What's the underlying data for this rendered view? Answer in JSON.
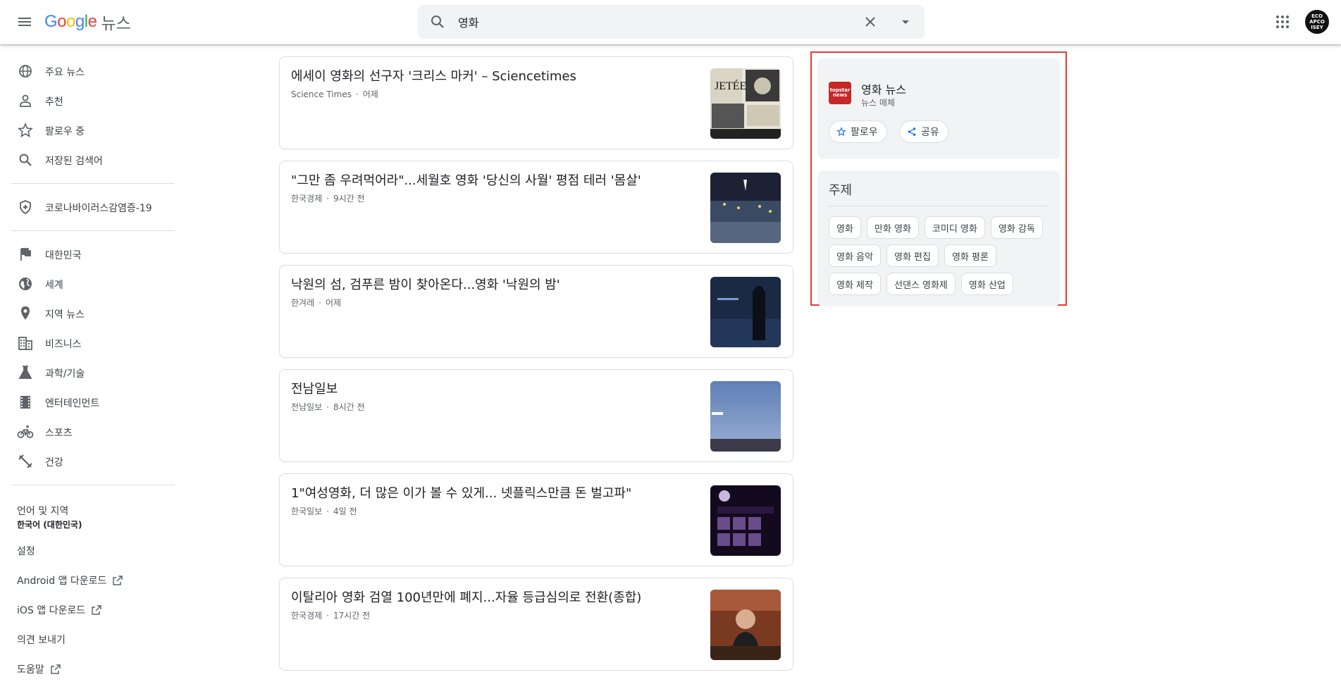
{
  "header": {
    "logo_google": "Google",
    "logo_news": "뉴스",
    "search_value": "영화",
    "avatar_text": "ECO APCO ISEY"
  },
  "sidebar": {
    "primary": [
      {
        "label": "주요 뉴스",
        "icon": "globe-icon"
      },
      {
        "label": "추천",
        "icon": "person-icon"
      },
      {
        "label": "팔로우 중",
        "icon": "star-icon"
      },
      {
        "label": "저장된 검색어",
        "icon": "search-icon"
      }
    ],
    "covid": {
      "label": "코로나바이러스감염증-19",
      "icon": "shield-icon"
    },
    "sections": [
      {
        "label": "대한민국",
        "icon": "flag-icon"
      },
      {
        "label": "세계",
        "icon": "world-icon"
      },
      {
        "label": "지역 뉴스",
        "icon": "location-icon"
      },
      {
        "label": "비즈니스",
        "icon": "building-icon"
      },
      {
        "label": "과학/기술",
        "icon": "flask-icon"
      },
      {
        "label": "엔터테인먼트",
        "icon": "film-icon"
      },
      {
        "label": "스포츠",
        "icon": "bike-icon"
      },
      {
        "label": "건강",
        "icon": "fitness-icon"
      }
    ],
    "language_label": "언어 및 지역",
    "language_value": "한국어 (대한민국)",
    "settings": "설정",
    "android": "Android 앱 다운로드",
    "ios": "iOS 앱 다운로드",
    "feedback": "의견 보내기",
    "help": "도움말"
  },
  "articles": [
    {
      "title": "에세이 영화의 선구자 '크리스 마커' – Sciencetimes",
      "source": "Science Times",
      "time": "어제"
    },
    {
      "title": "\"그만 좀 우려먹어라\"...세월호 영화 '당신의 사월' 평점 테러 '몸살'",
      "source": "한국경제",
      "time": "9시간 전"
    },
    {
      "title": "낙원의 섬, 검푸른 밤이 찾아온다...영화 '낙원의 밤'",
      "source": "한겨레",
      "time": "어제"
    },
    {
      "title": "전남일보",
      "source": "전남일보",
      "time": "8시간 전"
    },
    {
      "title": "1\"여성영화, 더 많은 이가 볼 수 있게... 넷플릭스만큼 돈 벌고파\"",
      "source": "한국일보",
      "time": "4일 전"
    },
    {
      "title": "이탈리아 영화 검열 100년만에 폐지...자율 등급심의로 전환(종합)",
      "source": "한국경제",
      "time": "17시간 전"
    }
  ],
  "publication": {
    "logo_line1": "topstar",
    "logo_line2": "news",
    "name": "영화 뉴스",
    "type": "뉴스 매체",
    "follow_label": "팔로우",
    "share_label": "공유"
  },
  "topics": {
    "title": "주제",
    "chips": [
      "영화",
      "만화 영화",
      "코미디 영화",
      "영화 감독",
      "영화 음악",
      "영화 편집",
      "영화 평론",
      "영화 제작",
      "선댄스 영화제",
      "영화 산업"
    ]
  },
  "colors": {
    "panel_highlight": "#e53935",
    "publication_logo": "#c62828",
    "panel_bg": "#f1f3f4"
  }
}
